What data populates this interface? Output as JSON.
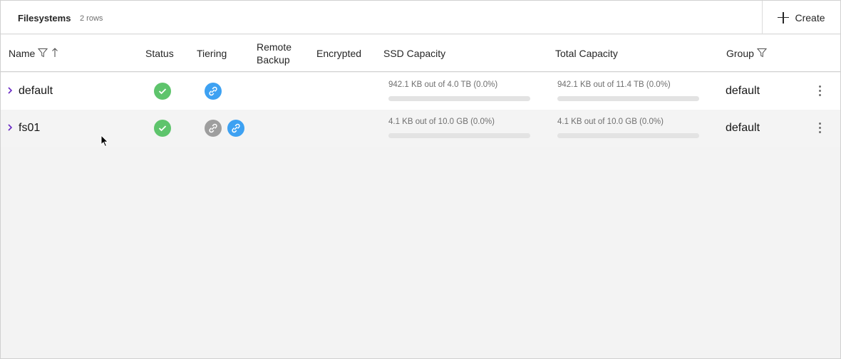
{
  "toolbar": {
    "title": "Filesystems",
    "row_count": "2 rows",
    "create_label": "Create"
  },
  "columns": {
    "name": "Name",
    "status": "Status",
    "tiering": "Tiering",
    "remote_backup_line1": "Remote",
    "remote_backup_line2": "Backup",
    "encrypted": "Encrypted",
    "ssd_capacity": "SSD Capacity",
    "total_capacity": "Total Capacity",
    "group": "Group"
  },
  "rows": [
    {
      "name": "default",
      "status": "ok",
      "tiering_icons": [
        "link-blue"
      ],
      "ssd_capacity": "942.1 KB out of 4.0 TB (0.0%)",
      "ssd_used_pct": 0.0,
      "total_capacity": "942.1 KB out of 11.4 TB (0.0%)",
      "total_used_pct": 0.0,
      "group": "default"
    },
    {
      "name": "fs01",
      "status": "ok",
      "tiering_icons": [
        "link-gray",
        "link-blue"
      ],
      "ssd_capacity": "4.1 KB out of 10.0 GB (0.0%)",
      "ssd_used_pct": 0.0,
      "total_capacity": "4.1 KB out of 10.0 GB (0.0%)",
      "total_used_pct": 0.0,
      "group": "default"
    }
  ],
  "colors": {
    "status_ok": "#5ec46c",
    "link_blue": "#3da1f2",
    "link_gray": "#9e9e9e",
    "chevron": "#6929c4"
  }
}
